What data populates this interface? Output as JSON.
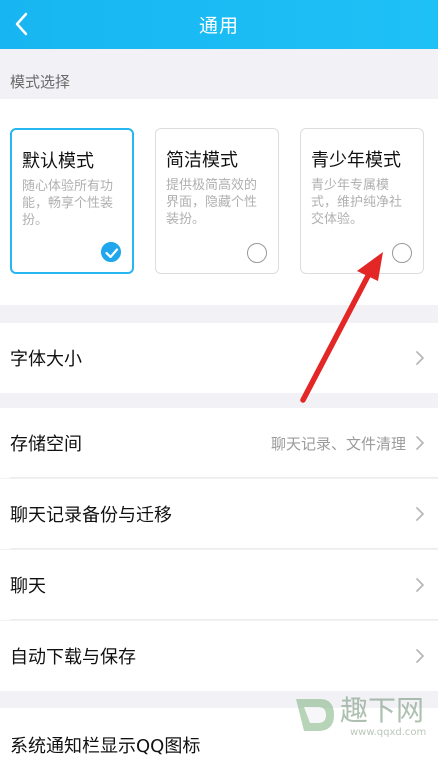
{
  "header": {
    "title": "通用"
  },
  "mode_section": {
    "label": "模式选择",
    "cards": [
      {
        "title": "默认模式",
        "desc": "随心体验所有功能，畅享个性装扮。",
        "selected": true
      },
      {
        "title": "简洁模式",
        "desc": "提供极简高效的界面，隐藏个性装扮。",
        "selected": false
      },
      {
        "title": "青少年模式",
        "desc": "青少年专属模式，维护纯净社交体验。",
        "selected": false
      }
    ]
  },
  "settings": {
    "font_size": {
      "label": "字体大小"
    },
    "storage": {
      "label": "存储空间",
      "value": "聊天记录、文件清理"
    },
    "backup": {
      "label": "聊天记录备份与迁移"
    },
    "chat": {
      "label": "聊天"
    },
    "auto_download": {
      "label": "自动下载与保存"
    },
    "notification_icon": {
      "label": "系统通知栏显示QQ图标"
    }
  },
  "watermark": {
    "text": "趣下网",
    "url": "www.qqxd.com"
  },
  "colors": {
    "header": "#1ebdf5",
    "accent": "#1fa6ec",
    "annotation_arrow": "#e32626"
  }
}
